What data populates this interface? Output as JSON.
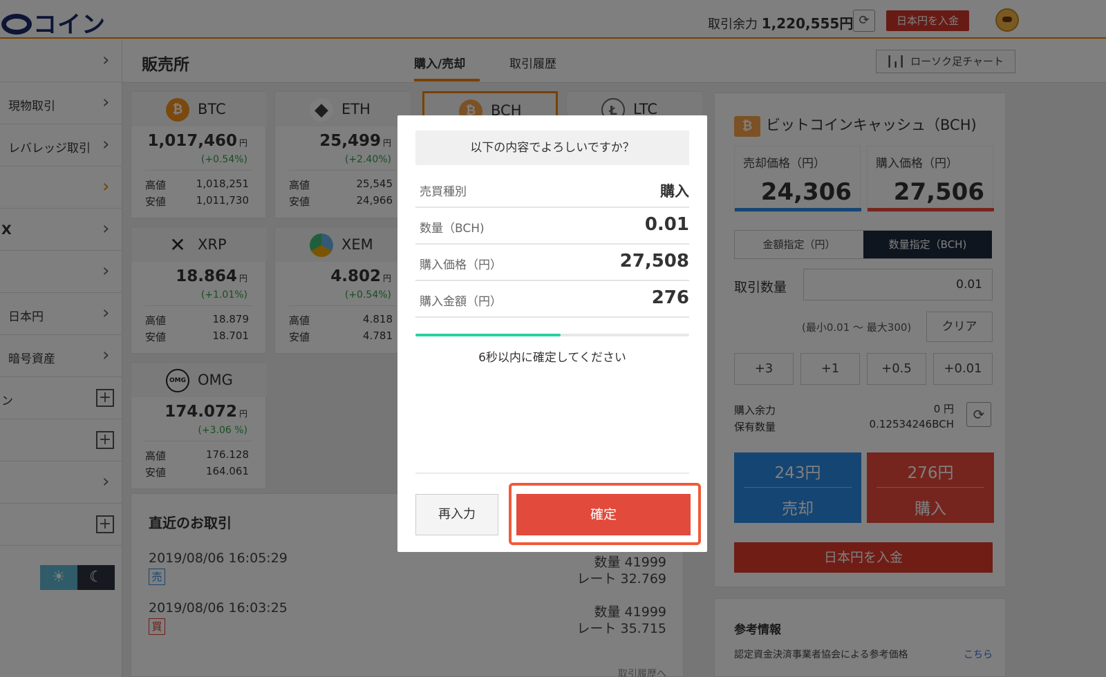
{
  "header": {
    "logo_text": "コイン",
    "balance_label": "取引余力",
    "balance_value": "1,220,555円",
    "deposit_button": "日本円を入金"
  },
  "sidebar": {
    "items": [
      {
        "label": "",
        "kind": "chevron"
      },
      {
        "label": "現物取引",
        "kind": "chevron"
      },
      {
        "label": "レバレッジ取引",
        "kind": "chevron"
      },
      {
        "label": "",
        "kind": "chevron"
      },
      {
        "label": "X",
        "kind": "chevron"
      },
      {
        "label": "",
        "kind": "chevron"
      },
      {
        "label": "日本円",
        "kind": "chevron"
      },
      {
        "label": "暗号資産",
        "kind": "chevron"
      },
      {
        "label": "ン",
        "kind": "plus"
      },
      {
        "label": "",
        "kind": "plus"
      },
      {
        "label": "",
        "kind": "chevron"
      },
      {
        "label": "",
        "kind": "plus"
      }
    ]
  },
  "subnav": {
    "title": "販売所",
    "tabs": [
      {
        "label": "購入/売却",
        "active": true
      },
      {
        "label": "取引履歴",
        "active": false
      }
    ],
    "candle_chart_button": "ローソク足チャート"
  },
  "coins": [
    {
      "symbol": "BTC",
      "price": "1,017,460",
      "unit": "円",
      "change": "(+0.54%)",
      "high_label": "高値",
      "high": "1,018,251",
      "low_label": "安値",
      "low": "1,011,730",
      "icon_color": "#f7931a",
      "icon": "bitcoin-icon"
    },
    {
      "symbol": "ETH",
      "price": "25,499",
      "unit": "円",
      "change": "(+2.40%)",
      "high_label": "高値",
      "high": "25,545",
      "low_label": "安値",
      "low": "24,966",
      "icon_color": "#3c3c3d",
      "icon": "ethereum-icon"
    },
    {
      "symbol": "XRP",
      "price": "18.864",
      "unit": "円",
      "change": "(+1.01%)",
      "high_label": "高値",
      "high": "18.879",
      "low_label": "安値",
      "low": "18.701",
      "icon_color": "#23292f",
      "icon": "ripple-icon"
    },
    {
      "symbol": "XEM",
      "price": "4.802",
      "unit": "円",
      "change": "(+0.54%)",
      "high_label": "高値",
      "high": "4.818",
      "low_label": "安値",
      "low": "4.781",
      "icon_color": "#67b2e8",
      "icon": "nem-icon"
    },
    {
      "symbol": "OMG",
      "price": "174.072",
      "unit": "円",
      "change": "(+3.06 %)",
      "high_label": "高値",
      "high": "176.128",
      "low_label": "安値",
      "low": "164.061",
      "icon_color": "#1a53f0",
      "icon": "omisego-icon"
    }
  ],
  "partial_cards": [
    "BCH",
    "LTC"
  ],
  "recent": {
    "title": "直近のお取引",
    "transactions": [
      {
        "time": "2019/08/06 16:05:29",
        "side": "売",
        "qty": "数量 41999",
        "rate": "レート 32.769"
      },
      {
        "time": "2019/08/06 16:03:25",
        "side": "買",
        "qty": "数量 41999",
        "rate": "レート 35.715"
      }
    ],
    "more_link": "取引履歴へ"
  },
  "trade_panel": {
    "title": "ビットコインキャッシュ（BCH)",
    "sell_price_label": "売却価格（円）",
    "sell_price": "24,306",
    "buy_price_label": "購入価格（円）",
    "buy_price": "27,506",
    "mode_amount": "金額指定（円）",
    "mode_qty": "数量指定（BCH)",
    "qty_label": "取引数量",
    "qty_value": "0.01",
    "range_note": "(最小0.01 ～ 最大300)",
    "clear_button": "クリア",
    "steps": [
      "+3",
      "+1",
      "+0.5",
      "+0.01"
    ],
    "avail_label": "購入余力",
    "avail_value": "0 円",
    "holding_label": "保有数量",
    "holding_value": "0.12534246BCH",
    "sell_amount": "243円",
    "sell_action": "売却",
    "buy_amount": "276円",
    "buy_action": "購入",
    "deposit_button": "日本円を入金"
  },
  "reference": {
    "title": "参考情報",
    "text": "認定資金決済事業者協会による参考価格",
    "link": "こちら"
  },
  "modal": {
    "question": "以下の内容でよろしいですか？",
    "rows": [
      {
        "key": "売買種別",
        "value": "購入"
      },
      {
        "key": "数量（BCH)",
        "value": "0.01"
      },
      {
        "key": "購入価格（円）",
        "value": "27,508"
      },
      {
        "key": "購入金額（円）",
        "value": "276"
      }
    ],
    "progress": 0.53,
    "timer_text": "6秒以内に確定してください",
    "reenter_button": "再入力",
    "confirm_button": "確定"
  },
  "colors": {
    "accent": "#f08300",
    "sell": "#2a8ae6",
    "buy": "#ea4b3c",
    "progress": "#27d3a0",
    "highlight": "#ef5a3a"
  }
}
